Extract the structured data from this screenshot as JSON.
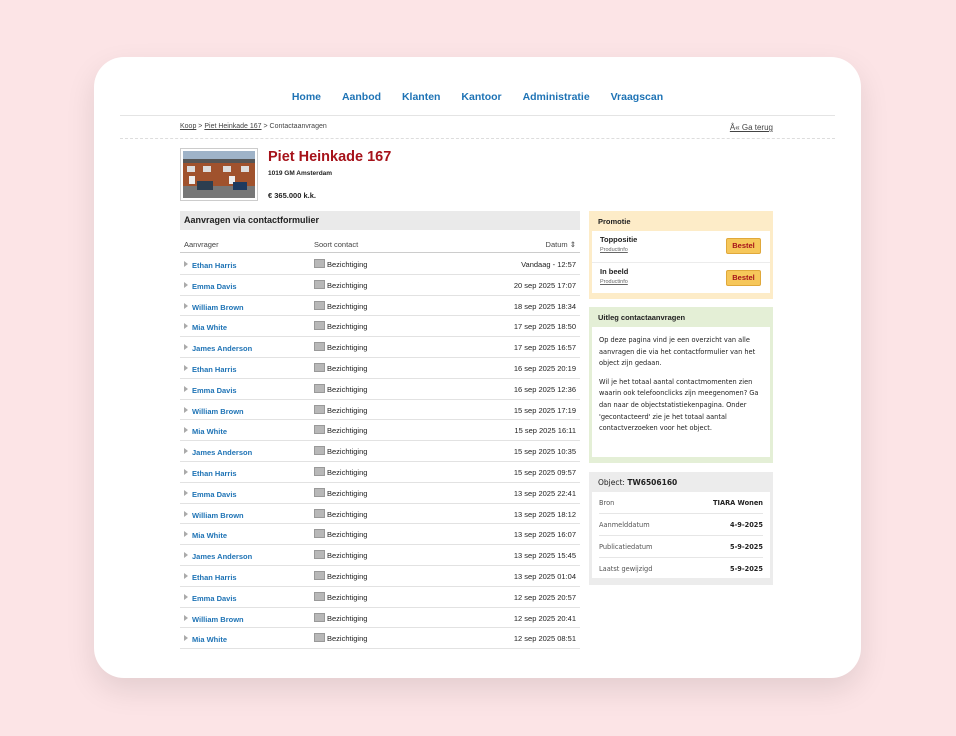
{
  "nav": [
    "Home",
    "Aanbod",
    "Klanten",
    "Kantoor",
    "Administratie",
    "Vraagscan"
  ],
  "breadcrumb": {
    "item1": "Koop",
    "sep": " > ",
    "item2": "Piet Heinkade 167",
    "item3": "Contactaanvragen",
    "back": "Â« Ga terug"
  },
  "property": {
    "title": "Piet Heinkade 167",
    "city": "1019 GM Amsterdam",
    "price": "€ 365.000 k.k."
  },
  "table": {
    "title": "Aanvragen via contactformulier",
    "headers": {
      "requester": "Aanvrager",
      "type": "Soort contact",
      "date": "Datum ⇕"
    },
    "rows": [
      {
        "name": "Ethan Harris",
        "type": "Bezichtiging",
        "date": "Vandaag - 12:57"
      },
      {
        "name": "Emma Davis",
        "type": "Bezichtiging",
        "date": "20 sep 2025 17:07"
      },
      {
        "name": "William Brown",
        "type": "Bezichtiging",
        "date": "18 sep 2025 18:34"
      },
      {
        "name": "Mia White",
        "type": "Bezichtiging",
        "date": "17 sep 2025 18:50"
      },
      {
        "name": "James Anderson",
        "type": "Bezichtiging",
        "date": "17 sep 2025 16:57"
      },
      {
        "name": "Ethan Harris",
        "type": "Bezichtiging",
        "date": "16 sep 2025 20:19"
      },
      {
        "name": "Emma Davis",
        "type": "Bezichtiging",
        "date": "16 sep 2025 12:36"
      },
      {
        "name": "William Brown",
        "type": "Bezichtiging",
        "date": "15 sep 2025 17:19"
      },
      {
        "name": "Mia White",
        "type": "Bezichtiging",
        "date": "15 sep 2025 16:11"
      },
      {
        "name": "James Anderson",
        "type": "Bezichtiging",
        "date": "15 sep 2025 10:35"
      },
      {
        "name": "Ethan Harris",
        "type": "Bezichtiging",
        "date": "15 sep 2025 09:57"
      },
      {
        "name": "Emma Davis",
        "type": "Bezichtiging",
        "date": "13 sep 2025 22:41"
      },
      {
        "name": "William Brown",
        "type": "Bezichtiging",
        "date": "13 sep 2025 18:12"
      },
      {
        "name": "Mia White",
        "type": "Bezichtiging",
        "date": "13 sep 2025 16:07"
      },
      {
        "name": "James Anderson",
        "type": "Bezichtiging",
        "date": "13 sep 2025 15:45"
      },
      {
        "name": "Ethan Harris",
        "type": "Bezichtiging",
        "date": "13 sep 2025 01:04"
      },
      {
        "name": "Emma Davis",
        "type": "Bezichtiging",
        "date": "12 sep 2025 20:57"
      },
      {
        "name": "William Brown",
        "type": "Bezichtiging",
        "date": "12 sep 2025 20:41"
      },
      {
        "name": "Mia White",
        "type": "Bezichtiging",
        "date": "12 sep 2025 08:51"
      }
    ]
  },
  "promo": {
    "title": "Promotie",
    "items": [
      {
        "title": "Toppositie",
        "link": "Productinfo",
        "button": "Bestel"
      },
      {
        "title": "In beeld",
        "link": "Productinfo",
        "button": "Bestel"
      }
    ]
  },
  "uitleg": {
    "title": "Uitleg contactaanvragen",
    "p1": "Op deze pagina vind je een overzicht van alle aanvragen die via het contactformulier van het object zijn gedaan.",
    "p2": "Wil je het totaal aantal contactmomenten zien waarin ook telefoonclicks zijn meegenomen? Ga dan naar de objectstatistiekenpagina. Onder 'gecontacteerd' zie je het totaal aantal contactverzoeken voor het object."
  },
  "object": {
    "label": "Object:",
    "id": "TW6506160",
    "rows": [
      {
        "key": "Bron",
        "value": "TIARA Wonen"
      },
      {
        "key": "Aanmelddatum",
        "value": "4-9-2025"
      },
      {
        "key": "Publicatiedatum",
        "value": "5-9-2025"
      },
      {
        "key": "Laatst gewijzigd",
        "value": "5-9-2025"
      }
    ]
  },
  "colors": {
    "link": "#1e73b5",
    "title": "#a6121a",
    "promo_bg": "#fdecc8",
    "uitleg_bg": "#e4efd6",
    "button": "#f6c75a"
  }
}
